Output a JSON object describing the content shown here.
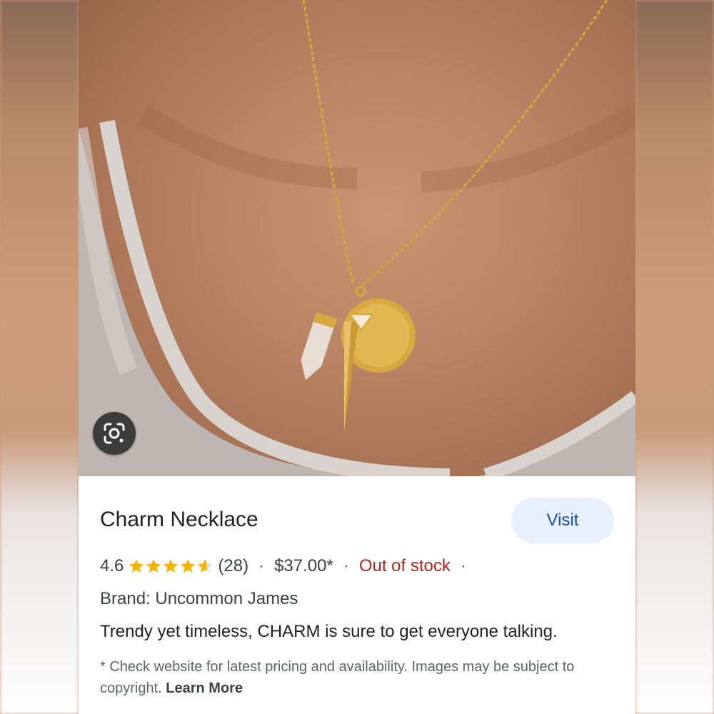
{
  "product": {
    "title": "Charm Necklace",
    "visit_label": "Visit",
    "rating": "4.6",
    "rating_value": 4.6,
    "review_count": "(28)",
    "price": "$37.00*",
    "stock_status": "Out of stock",
    "brand": "Brand: Uncommon James",
    "description": "Trendy yet timeless, CHARM is sure to get everyone talking.",
    "disclaimer": "* Check website for latest pricing and availability. Images may be subject to copyright.",
    "learn_more": "Learn More"
  },
  "separator": "·",
  "icons": {
    "lens": "google-lens-icon",
    "star": "star-icon"
  },
  "colors": {
    "star": "#f4b400",
    "out_of_stock": "#b3261e",
    "visit_bg": "#e8f0fe",
    "visit_text": "#1a4fa8"
  }
}
